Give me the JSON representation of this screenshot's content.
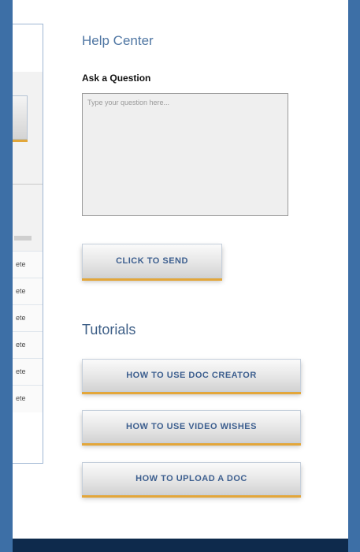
{
  "help": {
    "title": "Help Center",
    "ask_label": "Ask a Question",
    "question_placeholder": "Type your question here...",
    "send_label": "CLICK TO SEND"
  },
  "tutorials": {
    "title": "Tutorials",
    "items": [
      {
        "label": "HOW TO USE DOC CREATOR"
      },
      {
        "label": "HOW TO USE VIDEO WISHES"
      },
      {
        "label": "HOW TO UPLOAD A DOC"
      }
    ]
  },
  "left_panel": {
    "rows": [
      {
        "label": "ete"
      },
      {
        "label": "ete"
      },
      {
        "label": "ete"
      },
      {
        "label": "ete"
      },
      {
        "label": "ete"
      },
      {
        "label": "ete"
      }
    ]
  },
  "colors": {
    "background": "#3d6fa6",
    "accent": "#e3a63a",
    "title": "#4f76a3",
    "footer": "#0e2a4c"
  }
}
